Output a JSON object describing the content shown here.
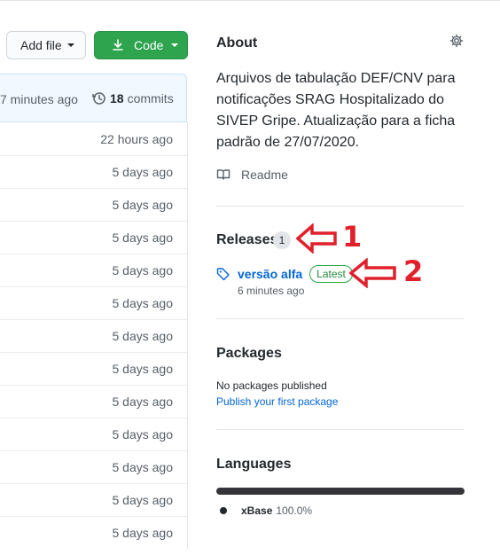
{
  "toolbar": {
    "add_file_label": "Add file",
    "code_label": "Code"
  },
  "commit_bar": {
    "ago": "7 minutes ago",
    "commit_count": "18",
    "commits_label": "commits"
  },
  "files": [
    {
      "time": "22 hours ago"
    },
    {
      "time": "5 days ago"
    },
    {
      "time": "5 days ago"
    },
    {
      "time": "5 days ago"
    },
    {
      "time": "5 days ago"
    },
    {
      "time": "5 days ago"
    },
    {
      "time": "5 days ago"
    },
    {
      "time": "5 days ago"
    },
    {
      "time": "5 days ago"
    },
    {
      "time": "5 days ago"
    },
    {
      "time": "5 days ago"
    },
    {
      "time": "5 days ago"
    },
    {
      "time": "5 days ago"
    }
  ],
  "about": {
    "title": "About",
    "description": "Arquivos de tabulação DEF/CNV para notificações SRAG Hospitalizado do SIVEP Gripe. Atualização para a ficha padrão de 27/07/2020.",
    "readme_label": "Readme"
  },
  "releases": {
    "title": "Releases",
    "count": "1",
    "latest_name": "versão alfa",
    "latest_badge": "Latest",
    "latest_time": "6 minutes ago"
  },
  "packages": {
    "title": "Packages",
    "empty_text": "No packages published",
    "publish_link": "Publish your first package"
  },
  "languages": {
    "title": "Languages",
    "items": [
      {
        "name": "xBase",
        "percent": "100.0%",
        "share": 1.0,
        "color": "#24292e"
      }
    ]
  },
  "annotations": [
    {
      "label": "1"
    },
    {
      "label": "2"
    }
  ],
  "colors": {
    "primary_button": "#2ea44f",
    "link": "#0366d6",
    "annotation": "#e0202a"
  },
  "icons": [
    "download-icon",
    "history-icon",
    "gear-icon",
    "book-icon",
    "tag-icon"
  ]
}
